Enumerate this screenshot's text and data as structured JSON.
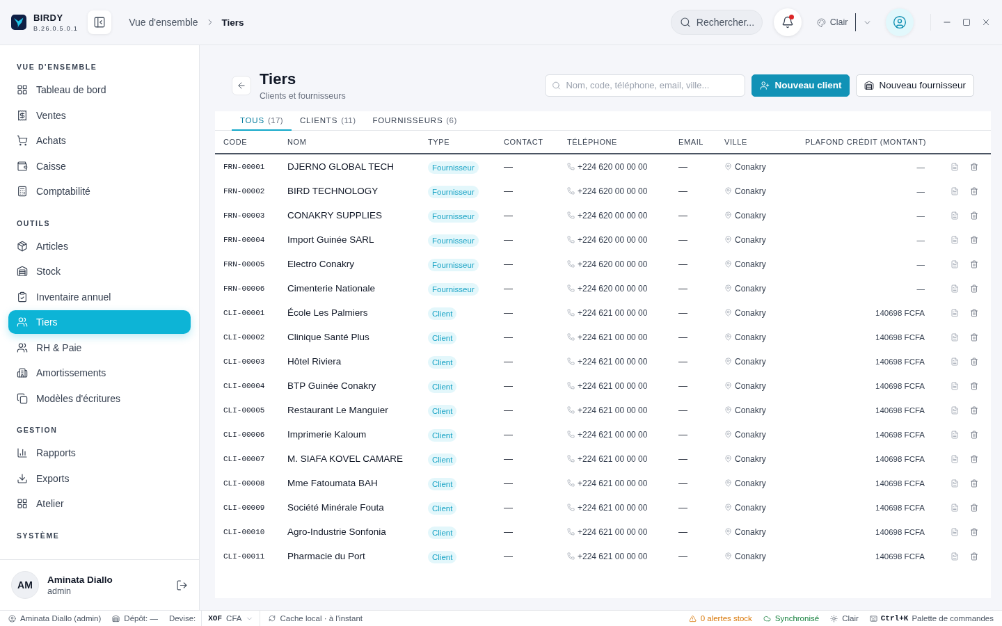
{
  "app": {
    "name": "BIRDY",
    "version": "B.26.0.5.0.1"
  },
  "breadcrumb": [
    "Vue d'ensemble",
    "Tiers"
  ],
  "topbar": {
    "search_placeholder": "Rechercher...",
    "notifications": {
      "unread": true
    },
    "theme": "Clair"
  },
  "sidebar": {
    "sections": [
      {
        "title": "VUE D'ENSEMBLE",
        "items": [
          {
            "label": "Tableau de bord",
            "selected": false
          },
          {
            "label": "Ventes",
            "selected": false
          },
          {
            "label": "Achats",
            "selected": false
          },
          {
            "label": "Caisse",
            "selected": false
          },
          {
            "label": "Comptabilité",
            "selected": false
          }
        ]
      },
      {
        "title": "OUTILS",
        "items": [
          {
            "label": "Articles",
            "selected": false
          },
          {
            "label": "Stock",
            "selected": false
          },
          {
            "label": "Inventaire annuel",
            "selected": false
          },
          {
            "label": "Tiers",
            "selected": true
          },
          {
            "label": "RH & Paie",
            "selected": false
          },
          {
            "label": "Amortissements",
            "selected": false
          },
          {
            "label": "Modèles d'écritures",
            "selected": false
          }
        ]
      },
      {
        "title": "GESTION",
        "items": [
          {
            "label": "Rapports",
            "selected": false
          },
          {
            "label": "Exports",
            "selected": false
          },
          {
            "label": "Atelier",
            "selected": false
          }
        ]
      },
      {
        "title": "SYSTÈME"
      }
    ],
    "user": {
      "initials": "AM",
      "name": "Aminata Diallo",
      "role": "admin"
    }
  },
  "page": {
    "title": "Tiers",
    "subtitle": "Clients et fournisseurs",
    "search_placeholder": "Nom, code, téléphone, email, ville...",
    "buttons": [
      {
        "label": "Nouveau client",
        "kind": "primary"
      },
      {
        "label": "Nouveau fournisseur",
        "kind": "secondary"
      }
    ]
  },
  "tabs": [
    {
      "label": "TOUS",
      "count": "(17)",
      "selected": true
    },
    {
      "label": "CLIENTS",
      "count": "(11)",
      "selected": false
    },
    {
      "label": "FOURNISSEURS",
      "count": "(6)",
      "selected": false
    }
  ],
  "table": {
    "columns": [
      "CODE",
      "NOM",
      "TYPE",
      "CONTACT",
      "TÉLÉPHONE",
      "EMAIL",
      "VILLE",
      "PLAFOND CRÉDIT (MONTANT)"
    ],
    "rows": [
      {
        "code": "FRN-00001",
        "name": "DJERNO GLOBAL TECH",
        "type": "Fournisseur",
        "contact": "—",
        "phone": "+224 620 00 00 00",
        "email": "—",
        "city": "Conakry",
        "credit": "—"
      },
      {
        "code": "FRN-00002",
        "name": "BIRD TECHNOLOGY",
        "type": "Fournisseur",
        "contact": "—",
        "phone": "+224 620 00 00 00",
        "email": "—",
        "city": "Conakry",
        "credit": "—"
      },
      {
        "code": "FRN-00003",
        "name": "CONAKRY SUPPLIES",
        "type": "Fournisseur",
        "contact": "—",
        "phone": "+224 620 00 00 00",
        "email": "—",
        "city": "Conakry",
        "credit": "—"
      },
      {
        "code": "FRN-00004",
        "name": "Import Guinée SARL",
        "type": "Fournisseur",
        "contact": "—",
        "phone": "+224 620 00 00 00",
        "email": "—",
        "city": "Conakry",
        "credit": "—"
      },
      {
        "code": "FRN-00005",
        "name": "Electro Conakry",
        "type": "Fournisseur",
        "contact": "—",
        "phone": "+224 620 00 00 00",
        "email": "—",
        "city": "Conakry",
        "credit": "—"
      },
      {
        "code": "FRN-00006",
        "name": "Cimenterie Nationale",
        "type": "Fournisseur",
        "contact": "—",
        "phone": "+224 620 00 00 00",
        "email": "—",
        "city": "Conakry",
        "credit": "—"
      },
      {
        "code": "CLI-00001",
        "name": "École Les Palmiers",
        "type": "Client",
        "contact": "—",
        "phone": "+224 621 00 00 00",
        "email": "—",
        "city": "Conakry",
        "credit": "140698 FCFA"
      },
      {
        "code": "CLI-00002",
        "name": "Clinique Santé Plus",
        "type": "Client",
        "contact": "—",
        "phone": "+224 621 00 00 00",
        "email": "—",
        "city": "Conakry",
        "credit": "140698 FCFA"
      },
      {
        "code": "CLI-00003",
        "name": "Hôtel Riviera",
        "type": "Client",
        "contact": "—",
        "phone": "+224 621 00 00 00",
        "email": "—",
        "city": "Conakry",
        "credit": "140698 FCFA"
      },
      {
        "code": "CLI-00004",
        "name": "BTP Guinée Conakry",
        "type": "Client",
        "contact": "—",
        "phone": "+224 621 00 00 00",
        "email": "—",
        "city": "Conakry",
        "credit": "140698 FCFA"
      },
      {
        "code": "CLI-00005",
        "name": "Restaurant Le Manguier",
        "type": "Client",
        "contact": "—",
        "phone": "+224 621 00 00 00",
        "email": "—",
        "city": "Conakry",
        "credit": "140698 FCFA"
      },
      {
        "code": "CLI-00006",
        "name": "Imprimerie Kaloum",
        "type": "Client",
        "contact": "—",
        "phone": "+224 621 00 00 00",
        "email": "—",
        "city": "Conakry",
        "credit": "140698 FCFA"
      },
      {
        "code": "CLI-00007",
        "name": "M. SIAFA KOVEL CAMARE",
        "type": "Client",
        "contact": "—",
        "phone": "+224 621 00 00 00",
        "email": "—",
        "city": "Conakry",
        "credit": "140698 FCFA"
      },
      {
        "code": "CLI-00008",
        "name": "Mme Fatoumata BAH",
        "type": "Client",
        "contact": "—",
        "phone": "+224 621 00 00 00",
        "email": "—",
        "city": "Conakry",
        "credit": "140698 FCFA"
      },
      {
        "code": "CLI-00009",
        "name": "Société Minérale Fouta",
        "type": "Client",
        "contact": "—",
        "phone": "+224 621 00 00 00",
        "email": "—",
        "city": "Conakry",
        "credit": "140698 FCFA"
      },
      {
        "code": "CLI-00010",
        "name": "Agro-Industrie Sonfonia",
        "type": "Client",
        "contact": "—",
        "phone": "+224 621 00 00 00",
        "email": "—",
        "city": "Conakry",
        "credit": "140698 FCFA"
      },
      {
        "code": "CLI-00011",
        "name": "Pharmacie du Port",
        "type": "Client",
        "contact": "—",
        "phone": "+224 621 00 00 00",
        "email": "—",
        "city": "Conakry",
        "credit": "140698 FCFA"
      }
    ]
  },
  "status_bar": {
    "user": "Aminata Diallo (admin)",
    "depot": "Dépôt: —",
    "currency_label": "Devise:",
    "currency_code": "XOF",
    "currency_name": "CFA",
    "cache": "Cache local · à l'instant",
    "alerts": "0 alertes stock",
    "sync": "Synchronisé",
    "theme": "Clair",
    "shortcut_key": "Ctrl+K",
    "shortcut_label": "Palette de commandes"
  }
}
